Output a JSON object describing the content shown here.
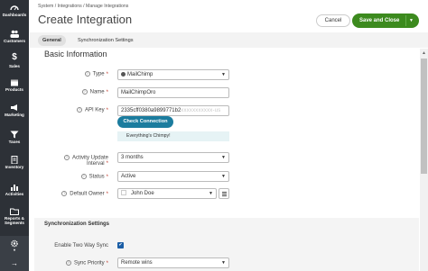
{
  "breadcrumb": "System / Integrations / Manage Integrations",
  "title": "Create Integration",
  "actions": {
    "cancel": "Cancel",
    "save_close": "Save and Close"
  },
  "tabs": [
    {
      "label": "General",
      "active": true
    },
    {
      "label": "Synchronization Settings",
      "active": false
    }
  ],
  "sidebar": [
    {
      "label": "Dashboards",
      "icon": "speedometer-icon"
    },
    {
      "label": "Customers",
      "icon": "users-icon"
    },
    {
      "label": "Sales",
      "icon": "dollar-icon"
    },
    {
      "label": "Products",
      "icon": "box-icon"
    },
    {
      "label": "Marketing",
      "icon": "megaphone-icon"
    },
    {
      "label": "Taxes",
      "icon": "filter-icon"
    },
    {
      "label": "Inventory",
      "icon": "clipboard-icon"
    },
    {
      "label": "Activities",
      "icon": "bars-chart-icon"
    },
    {
      "label": "Reports & Segments",
      "icon": "folder-icon"
    },
    {
      "label": "",
      "icon": "gear-icon"
    },
    {
      "label": "",
      "icon": "arrow-right-icon"
    }
  ],
  "form": {
    "section_title": "Basic Information",
    "type": {
      "label": "Type",
      "value": "MailChimp"
    },
    "name": {
      "label": "Name",
      "value": "MailChimpOro"
    },
    "api_key": {
      "label": "API Key",
      "value_visible": "2335cff0380a9899771b2",
      "value_blurred": "xxxxxxxxxxx-us"
    },
    "check_connection": "Check Connection",
    "success_message": "Everything's Chimpy!",
    "activity_interval": {
      "label": "Activity Update Interval",
      "value": "3 months"
    },
    "status": {
      "label": "Status",
      "value": "Active"
    },
    "default_owner": {
      "label": "Default Owner",
      "value": "John Doe"
    }
  },
  "sync": {
    "section_title": "Synchronization Settings",
    "two_way": {
      "label": "Enable Two Way Sync",
      "checked": true
    },
    "priority": {
      "label": "Sync Priority",
      "value": "Remote wins"
    }
  },
  "colors": {
    "sidebar_bg": "#2d3137",
    "save_bg": "#3c8a1e",
    "check_bg": "#1b7c9e",
    "checkbox": "#1b5ea6"
  }
}
